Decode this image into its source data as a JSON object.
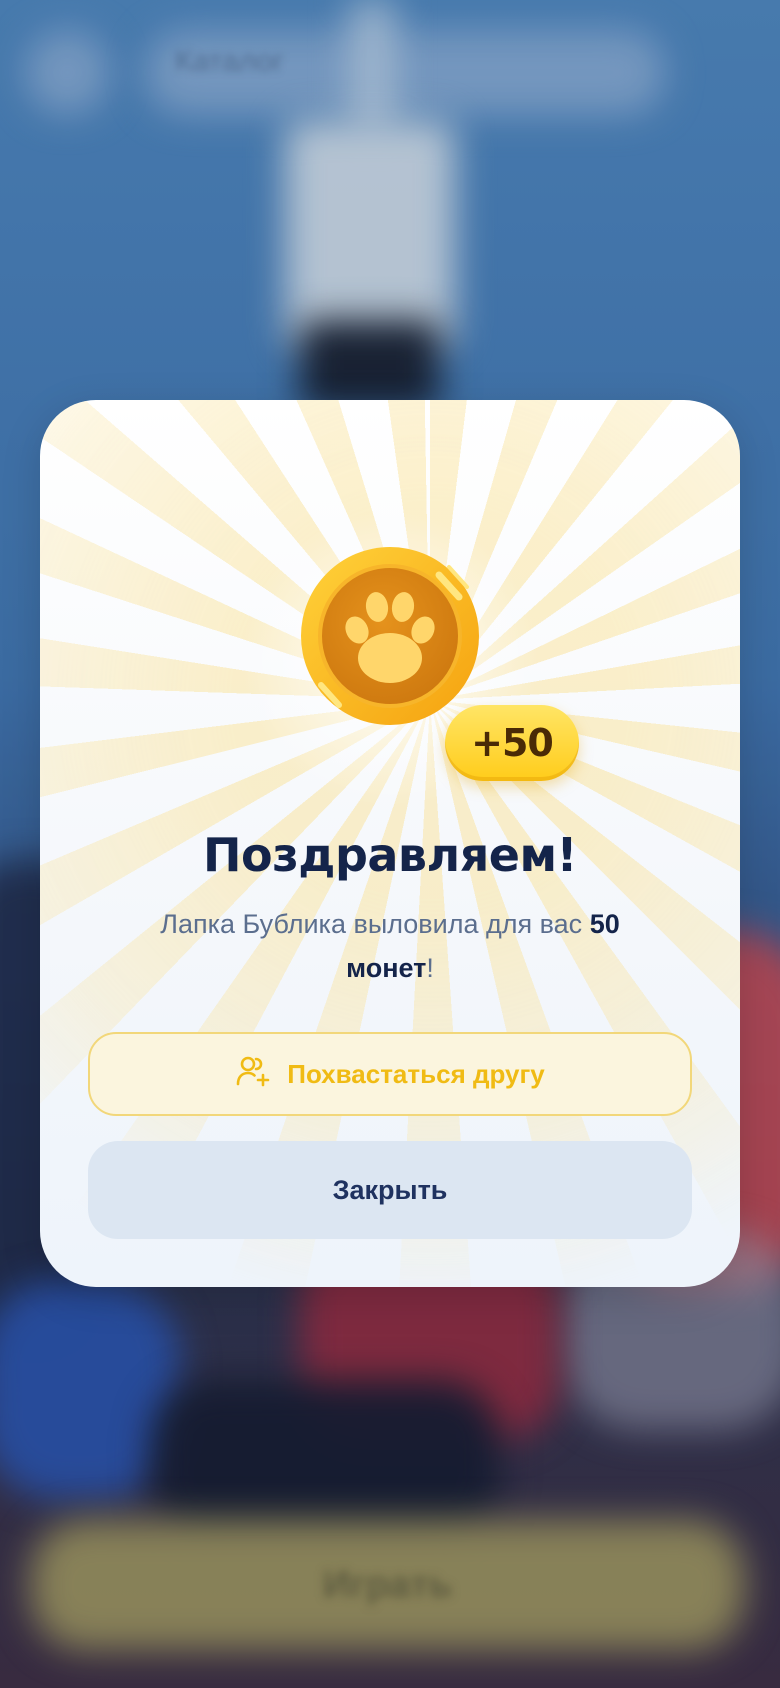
{
  "background": {
    "search_label": "Каталог",
    "bottom_button_label": "Играть"
  },
  "modal": {
    "coin_icon": "paw-coin-icon",
    "reward_badge": "+50",
    "title": "Поздравляем!",
    "message_prefix": "Лапка Бублика выловила для вас ",
    "message_amount": "50",
    "message_unit": "монет",
    "message_suffix": "!",
    "share_button": {
      "icon": "add-friend-icon",
      "label": "Похвастаться другу"
    },
    "close_button": {
      "label": "Закрыть"
    }
  },
  "colors": {
    "title": "#14244a",
    "accent_yellow": "#ffcc1a",
    "share_text": "#f0bb14",
    "close_bg": "#dce6f2"
  }
}
